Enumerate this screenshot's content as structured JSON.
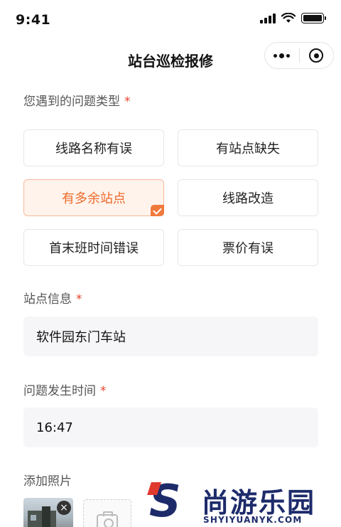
{
  "status_bar": {
    "time": "9:41"
  },
  "nav": {
    "title": "站台巡检报修"
  },
  "problem_type": {
    "label": "您遇到的问题类型",
    "required": "*",
    "options": [
      {
        "label": "线路名称有误",
        "selected": false
      },
      {
        "label": "有站点缺失",
        "selected": false
      },
      {
        "label": "有多余站点",
        "selected": true
      },
      {
        "label": "线路改造",
        "selected": false
      },
      {
        "label": "首末班时间错误",
        "selected": false
      },
      {
        "label": "票价有误",
        "selected": false
      }
    ]
  },
  "station_info": {
    "label": "站点信息",
    "required": "*",
    "value": "软件园东门车站"
  },
  "occur_time": {
    "label": "问题发生时间",
    "required": "*",
    "value": "16:47"
  },
  "photos": {
    "label": "添加照片",
    "remove_icon": "×"
  },
  "watermark": {
    "name": "尚游乐园",
    "url": "SHYIYUANYK.COM",
    "logo_letter": "S"
  },
  "colors": {
    "accent": "#ee6a2a",
    "required": "#e5432c",
    "field_bg": "#f6f6f8",
    "brand": "#1d2b6b"
  }
}
